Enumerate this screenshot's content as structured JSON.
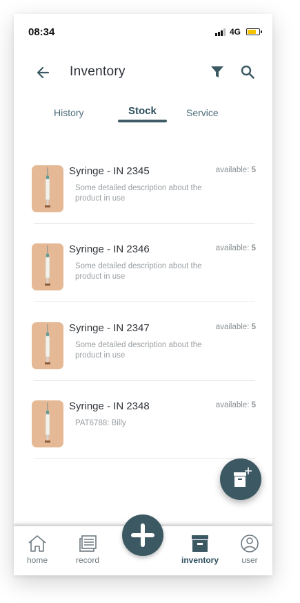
{
  "status_bar": {
    "time": "08:34",
    "network": "4G"
  },
  "header": {
    "title": "Inventory"
  },
  "tabs": [
    {
      "label": "History",
      "active": false
    },
    {
      "label": "Stock",
      "active": true
    },
    {
      "label": "Service",
      "active": false
    }
  ],
  "items": [
    {
      "name": "Syringe - IN 2345",
      "description": "Some detailed description about the product in use",
      "available_label": "available:",
      "available_count": "5"
    },
    {
      "name": "Syringe - IN 2346",
      "description": "Some detailed description about the product in use",
      "available_label": "available:",
      "available_count": "5"
    },
    {
      "name": "Syringe - IN 2347",
      "description": "Some detailed description about the product in use",
      "available_label": "available:",
      "available_count": "5"
    },
    {
      "name": "Syringe - IN 2348",
      "description": "PAT6788: Billy",
      "available_label": "available:",
      "available_count": "5"
    }
  ],
  "bottom_nav": {
    "home": "home",
    "record": "record",
    "inventory": "inventory",
    "user": "user"
  },
  "colors": {
    "accent": "#3c5963",
    "thumb_bg": "#e5b995",
    "battery": "#f5c400"
  },
  "icons": [
    "back-arrow-icon",
    "filter-icon",
    "search-icon",
    "add-box-icon",
    "home-icon",
    "record-icon",
    "plus-icon",
    "inventory-box-icon",
    "user-icon"
  ]
}
